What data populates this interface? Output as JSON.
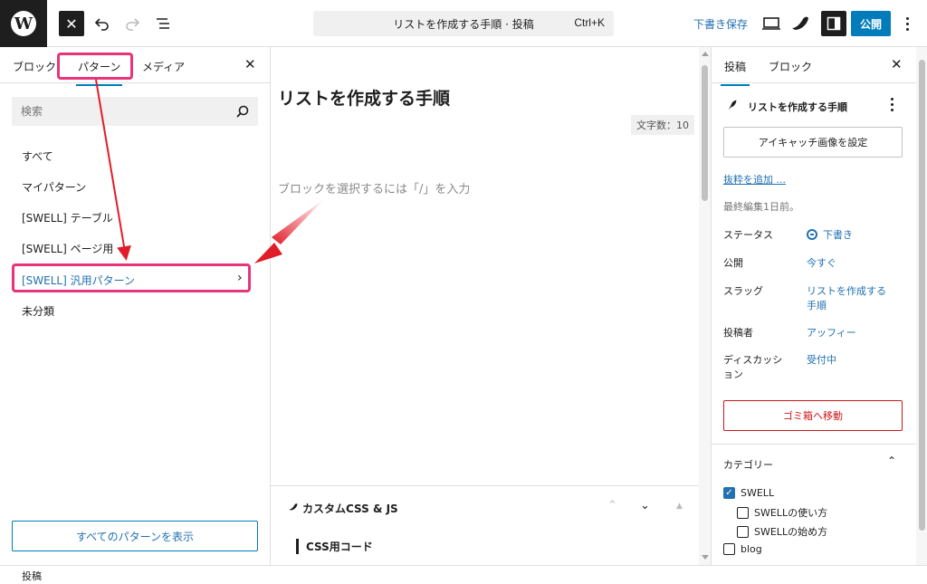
{
  "topbar": {
    "logo": "W",
    "close_icon": "✕",
    "command_title": "リストを作成する手順 · 投稿",
    "command_shortcut": "Ctrl+K",
    "save_draft": "下書き保存",
    "publish": "公開",
    "icons": [
      "wordpress-logo",
      "close-icon",
      "undo-icon",
      "redo-icon",
      "document-overview-icon",
      "view-icon",
      "swell-icon",
      "settings-sidebar-icon",
      "more-options-icon"
    ]
  },
  "inserter": {
    "tabs": [
      "ブロック",
      "パターン",
      "メディア"
    ],
    "active_tab": "パターン",
    "close": "✕",
    "search_placeholder": "検索",
    "categories": [
      "すべて",
      "マイパターン",
      "[SWELL] テーブル",
      "[SWELL] ページ用",
      "[SWELL] 汎用パターン",
      "未分類"
    ],
    "selected_category": "[SWELL] 汎用パターン",
    "chevron": "›",
    "all_patterns_button": "すべてのパターンを表示"
  },
  "canvas": {
    "post_title": "リストを作成する手順",
    "word_count": "文字数：10",
    "block_placeholder": "ブロックを選択するには「/」を入力",
    "meta_box_title": "カスタムCSS & JS",
    "css_label": "CSS用コード"
  },
  "sidebar": {
    "tabs": [
      "投稿",
      "ブロック"
    ],
    "active_tab": "投稿",
    "close": "✕",
    "post_title": "リストを作成する手順",
    "featured_image_button": "アイキャッチ画像を設定",
    "excerpt_link": "抜粋を追加 ...",
    "last_edited": "最終編集1日前。",
    "rows": [
      {
        "label": "ステータス",
        "value": "下書き"
      },
      {
        "label": "公開",
        "value": "今すぐ"
      },
      {
        "label": "スラッグ",
        "value": "リストを作成する\n手順"
      },
      {
        "label": "投稿者",
        "value": "アッフィー"
      },
      {
        "label": "ディスカッション",
        "value": "受付中"
      }
    ],
    "trash_button": "ゴミ箱へ移動",
    "category_panel_title": "カテゴリー",
    "category_checkboxes": [
      {
        "label": "SWELL",
        "checked": true
      },
      {
        "label": "SWELLの使い方",
        "checked": false
      },
      {
        "label": "SWELLの始め方",
        "checked": false
      },
      {
        "label": "blog",
        "checked": false
      }
    ]
  },
  "footer": {
    "breadcrumb": "投稿"
  },
  "colors": {
    "accent": "#007cba",
    "link": "#2271b1",
    "highlight": "#e8357a",
    "arrow": "#e11d2a",
    "danger": "#cc1818"
  }
}
